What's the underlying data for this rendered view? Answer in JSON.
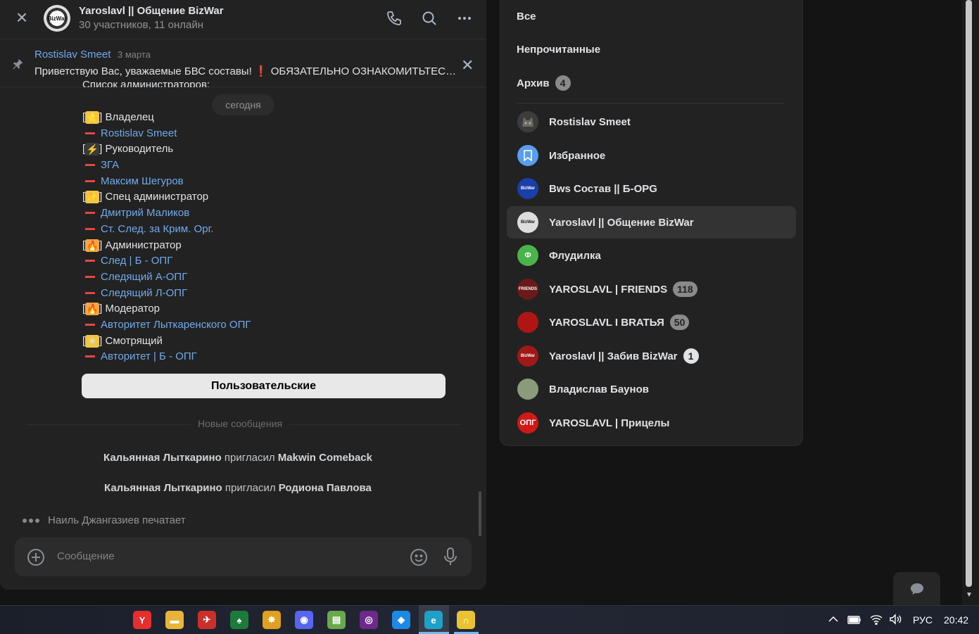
{
  "chat": {
    "title": "Yaroslavl || Общение BizWar",
    "subtitle": "30 участников, 11 онлайн",
    "avatar_text": "BizWar",
    "pinned": {
      "author": "Rostislav Smeet",
      "date": "3 марта",
      "text": "Приветствую Вас, уважаемые БВС составы! ❗ ОБЯЗАТЕЛЬНО ОЗНАКОМИТЬТЕСЬ С ПРАВИЛАМИ БЕСЕДЫ"
    },
    "cutoff_text": "Список администраторов:",
    "date_pill": "сегодня",
    "roles": [
      {
        "emoji": "⭐",
        "emoji_bg": "#f4c542",
        "label": "Владелец",
        "users": [
          "Rostislav Smeet"
        ]
      },
      {
        "emoji": "⚡",
        "emoji_bg": "#3a3a3a",
        "label": "Руководитель",
        "users": [
          "ЗГА",
          "Максим Шегуров"
        ]
      },
      {
        "emoji": "✨",
        "emoji_bg": "#f4c542",
        "label": "Спец администратор",
        "users": [
          "Дмитрий Маликов",
          "Ст. След. за Крим. Орг."
        ]
      },
      {
        "emoji": "🔥",
        "emoji_bg": "#f4a742",
        "label": "Администратор",
        "users": [
          "След | Б - ОПГ",
          "Следящий А-ОПГ",
          "Следящий Л-ОПГ"
        ]
      },
      {
        "emoji": "🔥",
        "emoji_bg": "#f4a742",
        "label": "Модератор",
        "users": [
          "Авторитет Лыткаренского ОПГ"
        ]
      },
      {
        "emoji": "☀",
        "emoji_bg": "#f4c542",
        "label": "Смотрящий",
        "users": [
          "Авторитет | Б - ОПГ"
        ]
      }
    ],
    "user_button": "Пользовательские",
    "new_messages_label": "Новые сообщения",
    "system_messages": [
      {
        "actor": "Кальянная Лыткарино",
        "verb": "пригласил",
        "target": "Makwin Comeback"
      },
      {
        "actor": "Кальянная Лыткарино",
        "verb": "пригласил",
        "target": "Родиона Павлова"
      }
    ],
    "typing": "Наиль Джангазиев печатает",
    "composer_placeholder": "Сообщение"
  },
  "list": {
    "filters": [
      {
        "label": "Все"
      },
      {
        "label": "Непрочитанные"
      },
      {
        "label": "Архив",
        "badge": "4"
      }
    ],
    "conversations": [
      {
        "name": "Rostislav Smeet",
        "avatar": "cat",
        "avatar_color": "#4a4a4a"
      },
      {
        "name": "Избранное",
        "avatar": "bookmark",
        "avatar_color": "#5a9cf0"
      },
      {
        "name": "Bws Состав || Б-OPG",
        "avatar": "BizWar",
        "avatar_color": "#1b3fa8"
      },
      {
        "name": "Yaroslavl || Общение BizWar",
        "avatar": "BizWar",
        "avatar_color": "#dddddd",
        "active": true
      },
      {
        "name": "Флудилка",
        "avatar": "Ф",
        "avatar_color": "#4bb34b"
      },
      {
        "name": "YAROSLAVL | FRIENDS",
        "avatar": "FRIENDS",
        "avatar_color": "#6b1a1a",
        "badge": "118"
      },
      {
        "name": "YAROSLAVL I BRATЬЯ",
        "avatar": "",
        "avatar_color": "#b01515",
        "badge": "50"
      },
      {
        "name": "Yaroslavl || Забив BizWar",
        "avatar": "BizWar",
        "avatar_color": "#a01818",
        "badge": "1",
        "badge_white": true
      },
      {
        "name": "Владислав Баунов",
        "avatar": "",
        "avatar_color": "#8a9a7a"
      },
      {
        "name": "YAROSLAVL | Прицелы",
        "avatar": "ОПГ",
        "avatar_color": "#d01818"
      }
    ]
  },
  "taskbar": {
    "apps": [
      {
        "name": "yandex-browser",
        "glyph": "Y",
        "color": "#e62e2e"
      },
      {
        "name": "file-explorer",
        "glyph": "▬",
        "color": "#e8b53a"
      },
      {
        "name": "game-app",
        "glyph": "✈",
        "color": "#c9302c"
      },
      {
        "name": "green-game",
        "glyph": "♠",
        "color": "#1e7a3a"
      },
      {
        "name": "spark-app",
        "glyph": "✸",
        "color": "#e0a020"
      },
      {
        "name": "discord",
        "glyph": "◉",
        "color": "#5865f2"
      },
      {
        "name": "notepad",
        "glyph": "▤",
        "color": "#6aa84f"
      },
      {
        "name": "obs",
        "glyph": "◎",
        "color": "#6e2a8a"
      },
      {
        "name": "vscode",
        "glyph": "◆",
        "color": "#1e88e5"
      },
      {
        "name": "edge",
        "glyph": "e",
        "color": "#1fa0c8"
      },
      {
        "name": "headset-app",
        "glyph": "∩",
        "color": "#e8c530"
      }
    ],
    "lang": "РУС",
    "time": "20:42"
  }
}
